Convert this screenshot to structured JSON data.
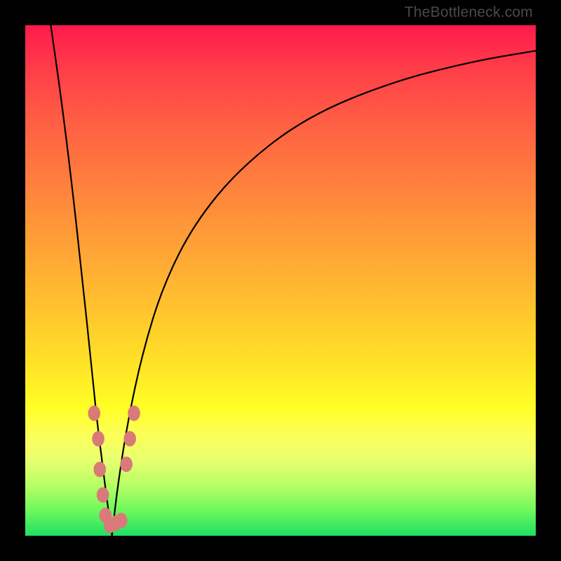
{
  "watermark": "TheBottleneck.com",
  "colors": {
    "frame": "#000000",
    "dot": "#d97a78",
    "curve": "#000000",
    "gradient_top": "#ff1a4d",
    "gradient_bottom": "#1ee063"
  },
  "chart_data": {
    "type": "line",
    "title": "",
    "xlabel": "",
    "ylabel": "",
    "xlim": [
      0,
      100
    ],
    "ylim": [
      0,
      100
    ],
    "note": "Axes unlabeled; values are pixel-read approximations on a 0-100 normalized scale. y=0 at bottom (green), y=100 at top (red).",
    "series": [
      {
        "name": "left-arm",
        "x": [
          5,
          7,
          9,
          11,
          13,
          14,
          15,
          16,
          17
        ],
        "values": [
          100,
          86,
          70,
          52,
          33,
          23,
          15,
          7,
          0
        ]
      },
      {
        "name": "right-arm",
        "x": [
          17,
          18,
          20,
          23,
          27,
          33,
          42,
          55,
          72,
          88,
          100
        ],
        "values": [
          0,
          9,
          22,
          36,
          49,
          61,
          72,
          82,
          89,
          93,
          95
        ]
      }
    ],
    "markers": [
      {
        "x": 13.5,
        "y": 24
      },
      {
        "x": 14.3,
        "y": 19
      },
      {
        "x": 14.6,
        "y": 13
      },
      {
        "x": 15.2,
        "y": 8
      },
      {
        "x": 15.7,
        "y": 4
      },
      {
        "x": 16.6,
        "y": 2
      },
      {
        "x": 17.8,
        "y": 2.5
      },
      {
        "x": 18.8,
        "y": 3
      },
      {
        "x": 19.8,
        "y": 14
      },
      {
        "x": 20.5,
        "y": 19
      },
      {
        "x": 21.3,
        "y": 24
      }
    ]
  }
}
